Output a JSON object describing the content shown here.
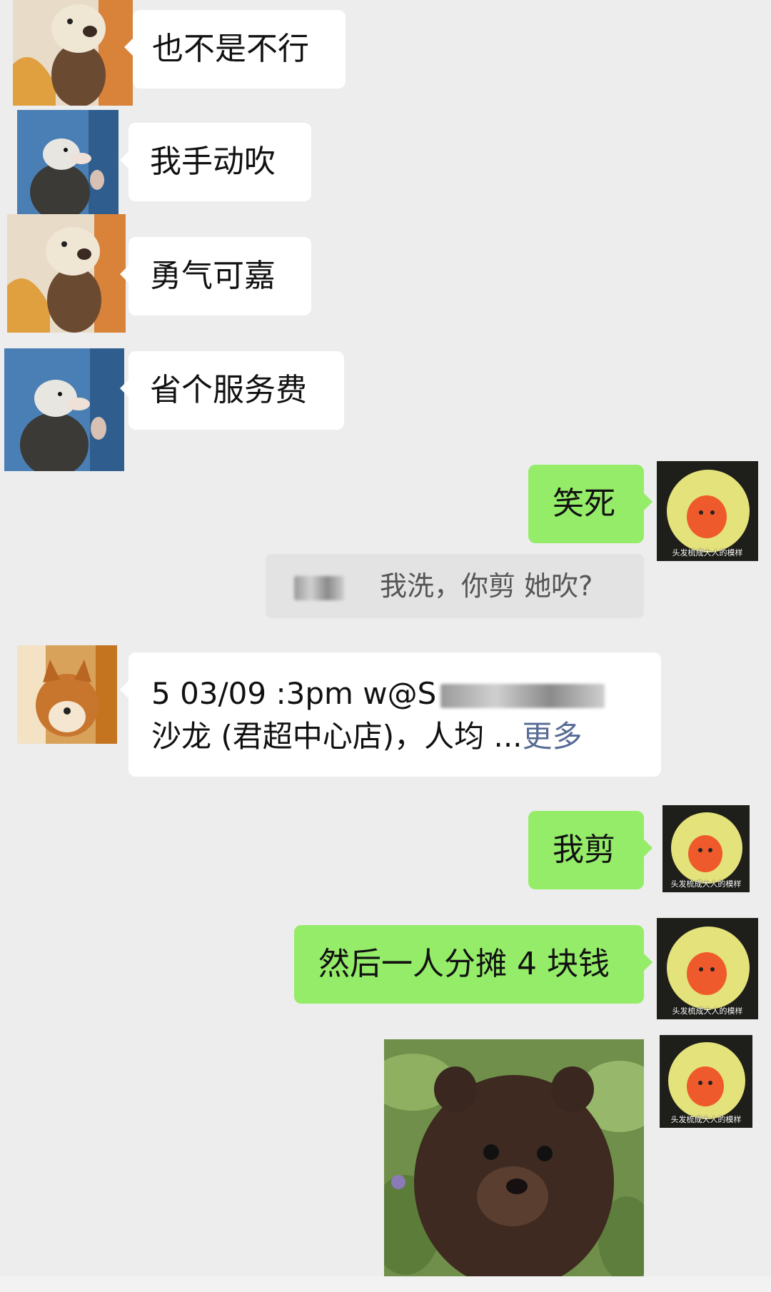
{
  "messages": [
    {
      "side": "left",
      "avatar": "otter-avatar",
      "text": "也不是不行"
    },
    {
      "side": "left",
      "avatar": "opossum-thumbs-up-avatar",
      "text": "我手动吹"
    },
    {
      "side": "left",
      "avatar": "otter-avatar",
      "text": "勇气可嘉"
    },
    {
      "side": "left",
      "avatar": "opossum-thumbs-up-avatar",
      "text": "省个服务费"
    },
    {
      "side": "right",
      "avatar": "yellow-hair-doll-avatar",
      "text": "笑死"
    },
    {
      "side": "right",
      "type": "quote",
      "text": "我洗，你剪 她吹?"
    },
    {
      "side": "left",
      "avatar": "shiba-avatar",
      "line1": "5 03/09 :3pm w@S",
      "line2": "沙龙 (君超中心店)，人均 ...",
      "more": "更多"
    },
    {
      "side": "right",
      "avatar": "yellow-hair-doll-avatar",
      "text": "我剪"
    },
    {
      "side": "right",
      "avatar": "yellow-hair-doll-avatar",
      "text": "然后一人分摊 4 块钱"
    },
    {
      "side": "right",
      "avatar": "yellow-hair-doll-avatar",
      "type": "image",
      "image": "bear-cub-sticker"
    }
  ],
  "avatar_caption": "头发梳成大人的模样",
  "colors": {
    "background": "#ededed",
    "bubble_in": "#ffffff",
    "bubble_out": "#95ec69",
    "link": "#576b95"
  }
}
